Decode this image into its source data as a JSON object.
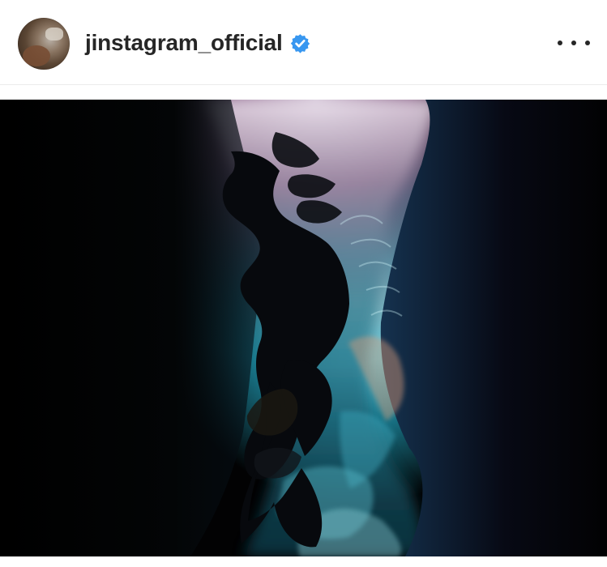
{
  "post": {
    "username": "jinstagram_official",
    "verified": true,
    "avatar_icon": "profile-photo",
    "verified_icon": "verified-badge-icon",
    "more_icon": "more-options-icon",
    "photo_subject": "underwater-diver-cave"
  },
  "colors": {
    "verified_blue": "#3897f0",
    "text": "#262626",
    "divider": "#ececec"
  }
}
